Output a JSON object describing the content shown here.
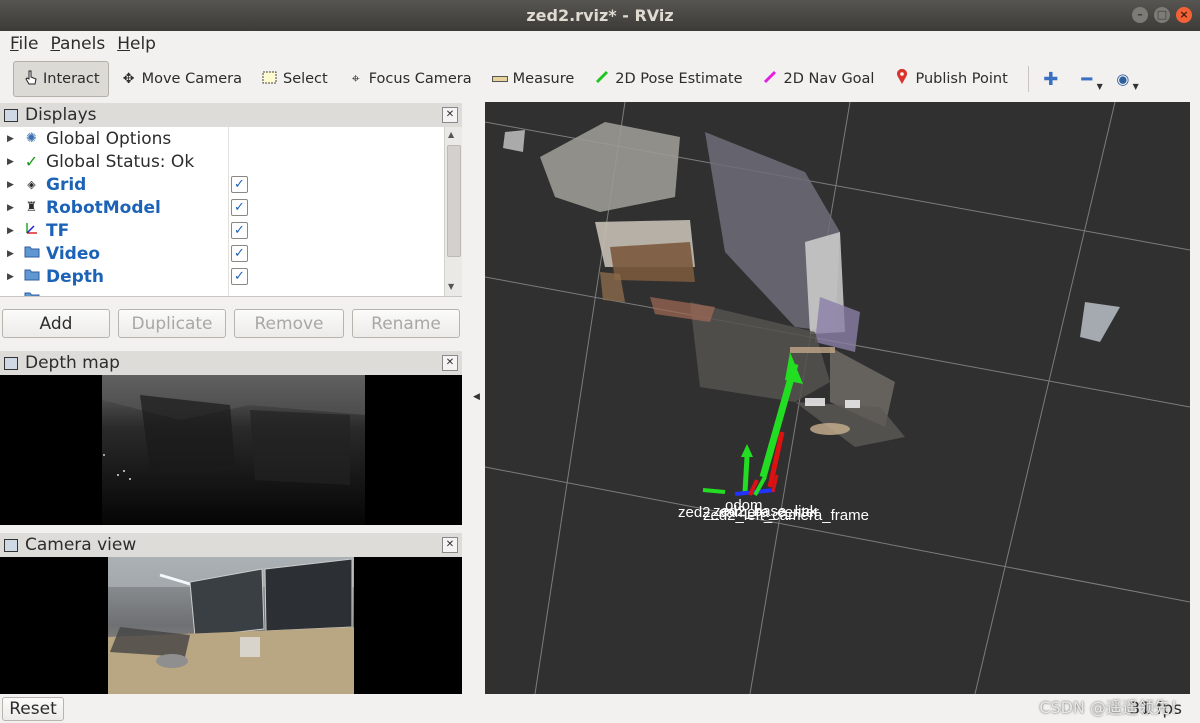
{
  "window": {
    "title": "zed2.rviz* - RViz",
    "controls": [
      "minimize",
      "maximize",
      "close"
    ]
  },
  "menu": {
    "file": {
      "mnemonic": "F",
      "rest": "ile"
    },
    "panels": {
      "mnemonic": "P",
      "rest": "anels"
    },
    "help": {
      "mnemonic": "H",
      "rest": "elp"
    }
  },
  "toolbar": {
    "tools": [
      {
        "label": "Interact",
        "icon": "cursor-icon",
        "active": true
      },
      {
        "label": "Move Camera",
        "icon": "move-icon"
      },
      {
        "label": "Select",
        "icon": "select-box-icon"
      },
      {
        "label": "Focus Camera",
        "icon": "crosshair-icon"
      },
      {
        "label": "Measure",
        "icon": "ruler-icon"
      },
      {
        "label": "2D Pose Estimate",
        "icon": "green-arrow-icon",
        "color": "#1fc41f"
      },
      {
        "label": "2D Nav Goal",
        "icon": "magenta-arrow-icon",
        "color": "#e21ee2"
      },
      {
        "label": "Publish Point",
        "icon": "map-pin-icon",
        "color": "#d9342b"
      }
    ],
    "extra": [
      "plus-icon",
      "minus-icon",
      "eye-icon"
    ]
  },
  "displays_panel": {
    "title": "Displays",
    "items": [
      {
        "label": "Global Options",
        "icon": "gear-icon",
        "bold": false,
        "checked": null
      },
      {
        "label": "Global Status: Ok",
        "icon": "check-icon",
        "bold": false,
        "checked": null
      },
      {
        "label": "Grid",
        "icon": "grid-icon",
        "bold": true,
        "checked": true
      },
      {
        "label": "RobotModel",
        "icon": "robot-icon",
        "bold": true,
        "checked": true
      },
      {
        "label": "TF",
        "icon": "axes-icon",
        "bold": true,
        "checked": true
      },
      {
        "label": "Video",
        "icon": "folder-icon",
        "bold": true,
        "checked": true
      },
      {
        "label": "Depth",
        "icon": "folder-icon",
        "bold": true,
        "checked": true
      }
    ],
    "buttons": {
      "add": "Add",
      "duplicate": "Duplicate",
      "remove": "Remove",
      "rename": "Rename"
    }
  },
  "depth_panel": {
    "title": "Depth map"
  },
  "camera_panel": {
    "title": "Camera view"
  },
  "viewport": {
    "frame_labels": [
      "zed2_camera_center",
      "zed2_left_camera_frame",
      "zed2_base_link",
      "odom"
    ]
  },
  "statusbar": {
    "reset": "Reset",
    "fps": "31 fps"
  },
  "watermark": "CSDN @遥遥领先！",
  "colors": {
    "accent_blue": "#1c63b7",
    "viewport_bg": "#303030",
    "axis_green": "#22dd22",
    "axis_red": "#dd1111",
    "axis_blue": "#2233ff"
  }
}
